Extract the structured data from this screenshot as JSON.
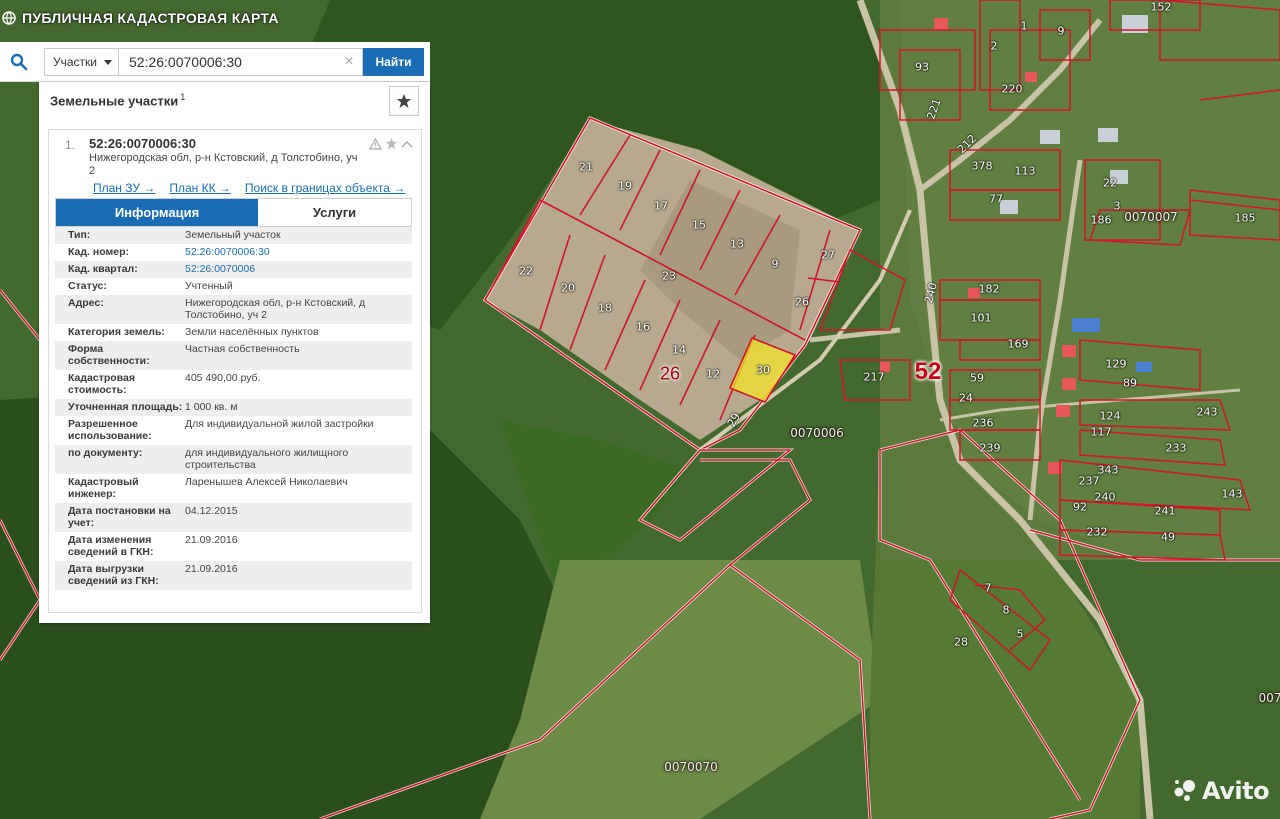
{
  "header": {
    "title": "ПУБЛИЧНАЯ КАДАСТРОВАЯ КАРТА",
    "icon": "globe-icon"
  },
  "search": {
    "type_label": "Участки",
    "value": "52:26:0070006:30",
    "find_label": "Найти",
    "clear_glyph": "×"
  },
  "panel": {
    "title": "Земельные участки",
    "count": "1",
    "result": {
      "number": "1.",
      "cad_number": "52:26:0070006:30",
      "address": "Нижегородская обл, р-н Кстовский, д Толстобино, уч 2",
      "links": [
        "План ЗУ →",
        "План КК →",
        "Поиск в границах объекта →"
      ]
    },
    "tabs": {
      "info": "Информация",
      "services": "Услуги"
    },
    "attributes": [
      {
        "label": "Тип:",
        "value": "Земельный участок"
      },
      {
        "label": "Кад. номер:",
        "value": "52:26:0070006:30",
        "link": true
      },
      {
        "label": "Кад. квартал:",
        "value": "52:26:0070006",
        "link": true
      },
      {
        "label": "Статус:",
        "value": "Учтенный"
      },
      {
        "label": "Адрес:",
        "value": "Нижегородская обл, р-н Кстовский, д Толстобино, уч 2"
      },
      {
        "label": "Категория земель:",
        "value": "Земли населённых пунктов"
      },
      {
        "label": "Форма собственности:",
        "value": "Частная собственность"
      },
      {
        "label": "Кадастровая стоимость:",
        "value": "405 490,00 руб."
      },
      {
        "label": "Уточненная площадь:",
        "value": "1 000 кв. м"
      },
      {
        "label": "Разрешенное использование:",
        "value": "Для индивидуальной жилой застройки"
      },
      {
        "label": "по документу:",
        "value": "для индивидуального жилищного строительства"
      },
      {
        "label": "Кадастровый инженер:",
        "value": "Ларенышев Алексей Николаевич"
      },
      {
        "label": "Дата постановки на учет:",
        "value": "04.12.2015"
      },
      {
        "label": "Дата изменения сведений в ГКН:",
        "value": "21.09.2016"
      },
      {
        "label": "Дата выгрузки сведений из ГКН:",
        "value": "21.09.2016"
      }
    ]
  },
  "map": {
    "plot_numbers": [
      "21",
      "19",
      "17",
      "15",
      "13",
      "9",
      "27",
      "26",
      "22",
      "20",
      "18",
      "23",
      "16",
      "14",
      "12",
      "30",
      "29",
      "217",
      "93",
      "221",
      "1",
      "2",
      "220",
      "9",
      "212",
      "378",
      "113",
      "77",
      "22",
      "3",
      "186",
      "185",
      "240",
      "182",
      "101",
      "169",
      "129",
      "89",
      "59",
      "24",
      "236",
      "239",
      "124",
      "243",
      "117",
      "233",
      "343",
      "237",
      "240",
      "143",
      "92",
      "241",
      "232",
      "49",
      "7",
      "8",
      "5",
      "28",
      "152"
    ],
    "quarter_labels": [
      "0070007",
      "0070006",
      "0070070",
      "007"
    ],
    "district_number": "26",
    "region_number": "52"
  },
  "watermark": {
    "text": "Avito"
  },
  "colors": {
    "accent": "#1a6db5",
    "boundary": "#d2142a",
    "selected_parcel": "#f3e62a"
  }
}
